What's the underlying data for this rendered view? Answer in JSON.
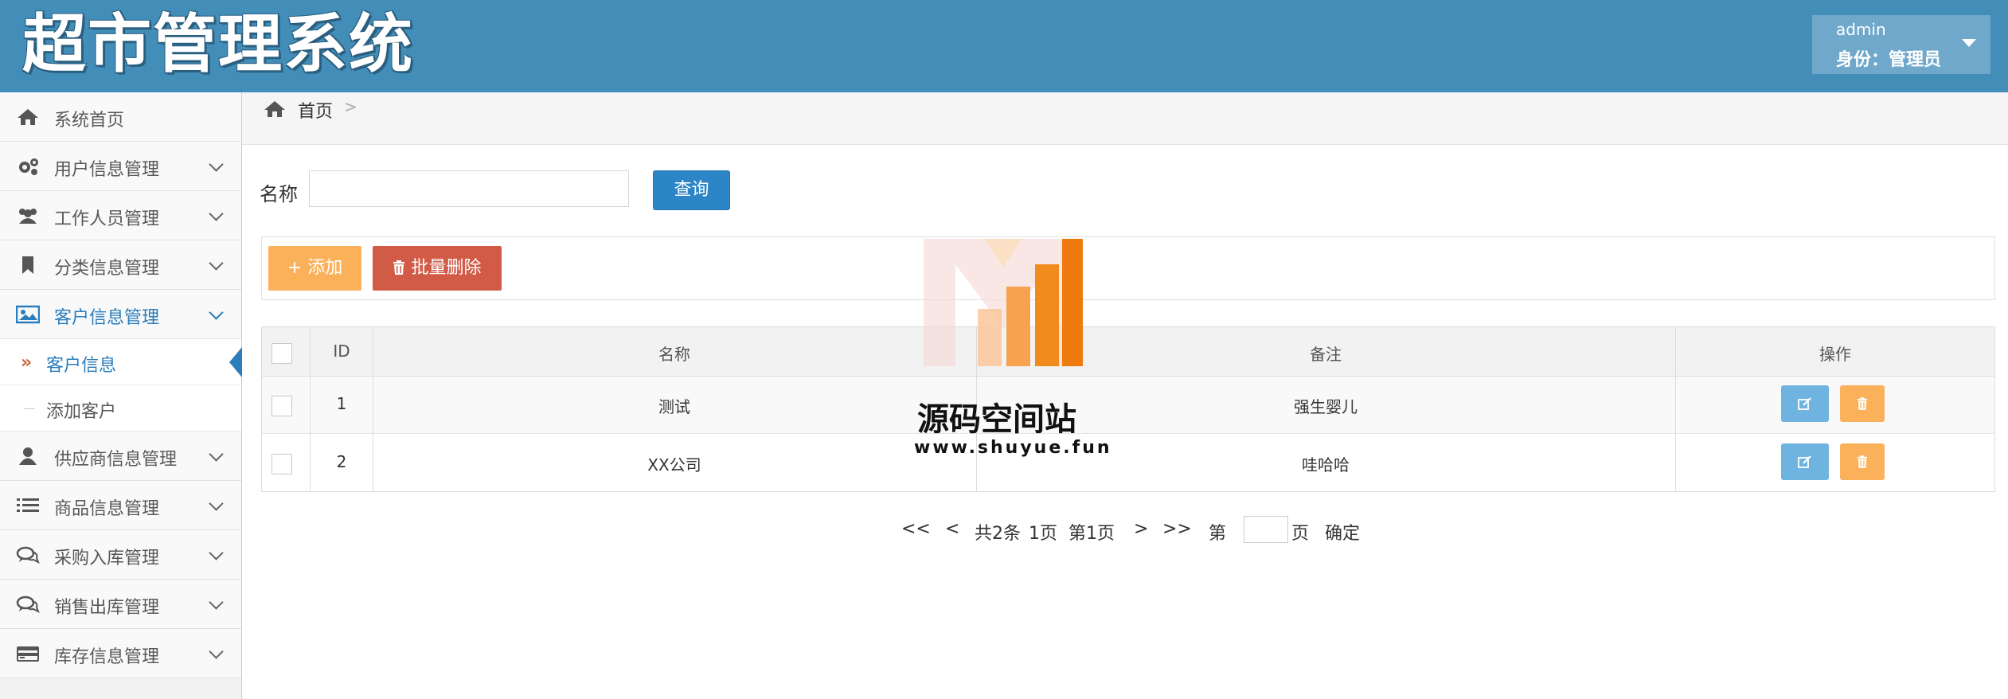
{
  "header": {
    "logo": "超市管理系统",
    "user_name": "admin",
    "user_role": "身份：管理员"
  },
  "sidebar": {
    "items": [
      {
        "label": "系统首页",
        "icon": "home-icon"
      },
      {
        "label": "用户信息管理",
        "icon": "cogs-icon"
      },
      {
        "label": "工作人员管理",
        "icon": "users-icon"
      },
      {
        "label": "分类信息管理",
        "icon": "bookmark-icon"
      },
      {
        "label": "客户信息管理",
        "icon": "picture-icon"
      },
      {
        "label": "供应商信息管理",
        "icon": "user-icon"
      },
      {
        "label": "商品信息管理",
        "icon": "list-icon"
      },
      {
        "label": "采购入库管理",
        "icon": "comments-icon"
      },
      {
        "label": "销售出库管理",
        "icon": "comments-icon"
      },
      {
        "label": "库存信息管理",
        "icon": "credit-card-icon"
      }
    ],
    "sub_items": [
      {
        "label": "客户信息"
      },
      {
        "label": "添加客户"
      }
    ]
  },
  "breadcrumb": {
    "home": "首页",
    "separator": ">"
  },
  "search": {
    "label": "名称",
    "value": "",
    "button": "查询"
  },
  "toolbar": {
    "add_label": "+ 添加",
    "delete_label": "批量删除"
  },
  "table": {
    "columns": [
      "ID",
      "名称",
      "备注",
      "操作"
    ],
    "rows": [
      {
        "id": "1",
        "name": "测试",
        "remark": "强生婴儿"
      },
      {
        "id": "2",
        "name": "XX公司",
        "remark": "哇哈哈"
      }
    ]
  },
  "pagination": {
    "first": "<<",
    "prev": "<",
    "total": "共2条",
    "pages": "1页",
    "current": "第1页",
    "next": ">",
    "last": ">>",
    "goto_prefix": "第",
    "goto_suffix": "页",
    "confirm": "确定"
  },
  "watermark": {
    "title": "源码空间站",
    "url": "www.shuyue.fun"
  },
  "colors": {
    "header": "#438eb9",
    "accent": "#2b7dbc",
    "add": "#fbb05a",
    "delete": "#d15b47",
    "edit": "#6fb3e0"
  }
}
